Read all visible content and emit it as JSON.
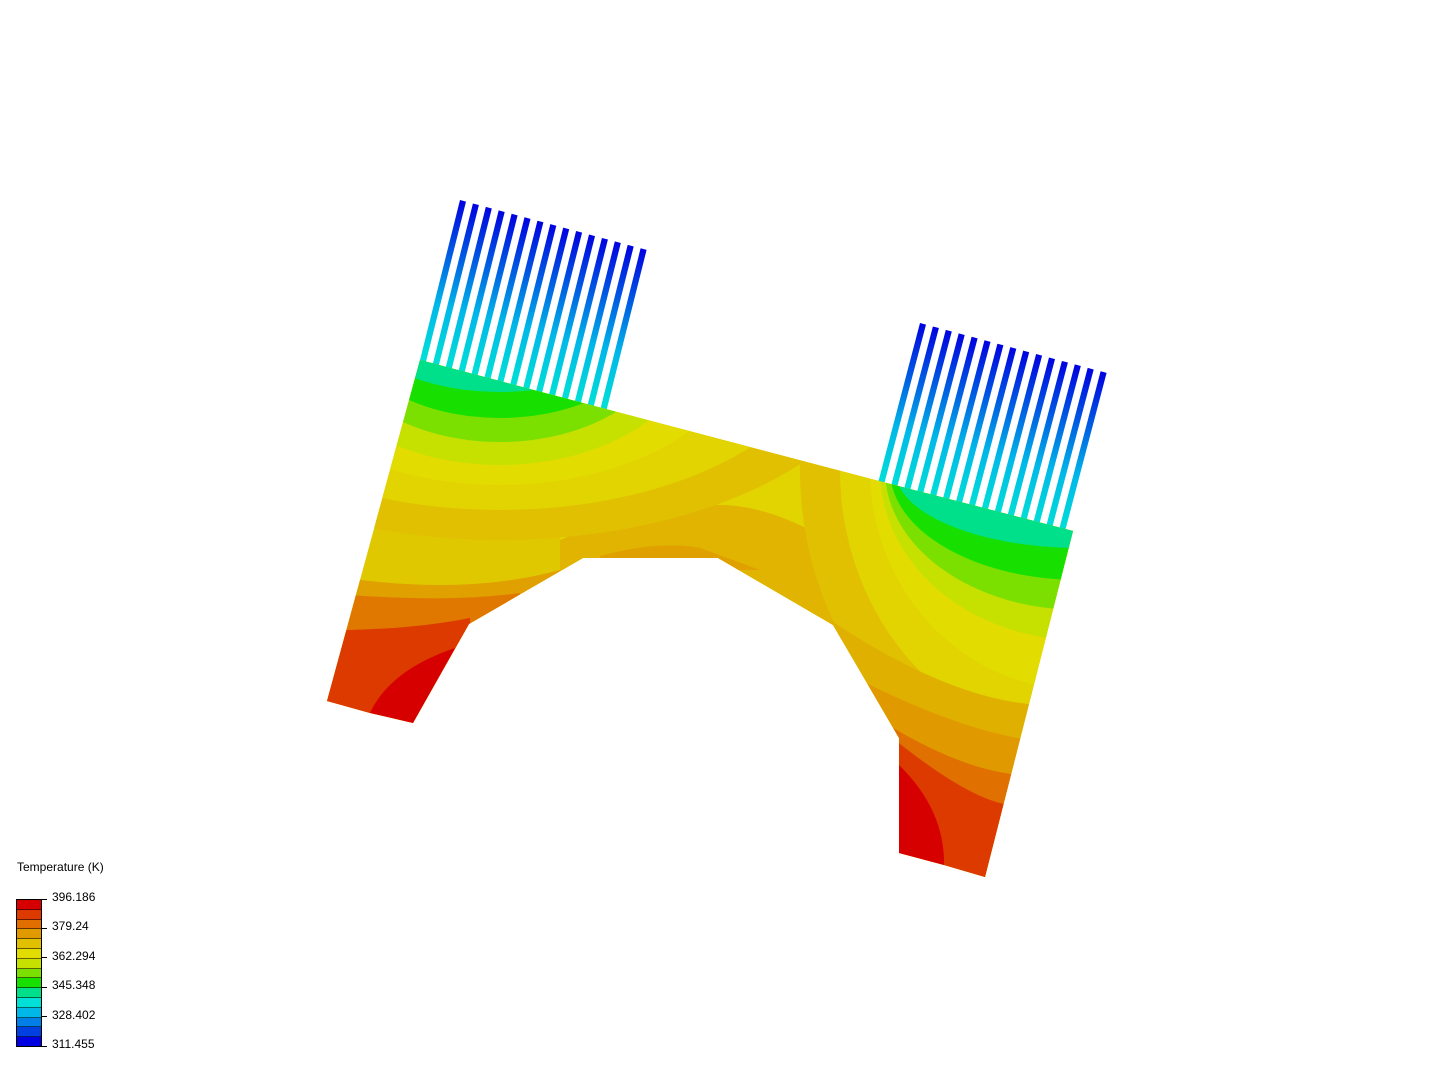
{
  "legend": {
    "title": "Temperature (K)",
    "labels": [
      "396.186",
      "379.24",
      "362.294",
      "345.348",
      "328.402",
      "311.455"
    ],
    "colormap": [
      "#d70000",
      "#dd3a00",
      "#e06e00",
      "#e09a00",
      "#e0c000",
      "#e2dc00",
      "#c6e000",
      "#7be000",
      "#17e000",
      "#00e08a",
      "#00e0d6",
      "#00b8e8",
      "#0080e6",
      "#0040e0",
      "#0000e0"
    ]
  },
  "colors": {
    "hot": "#d70000",
    "cold": "#0000e0",
    "background": "#ffffff"
  }
}
